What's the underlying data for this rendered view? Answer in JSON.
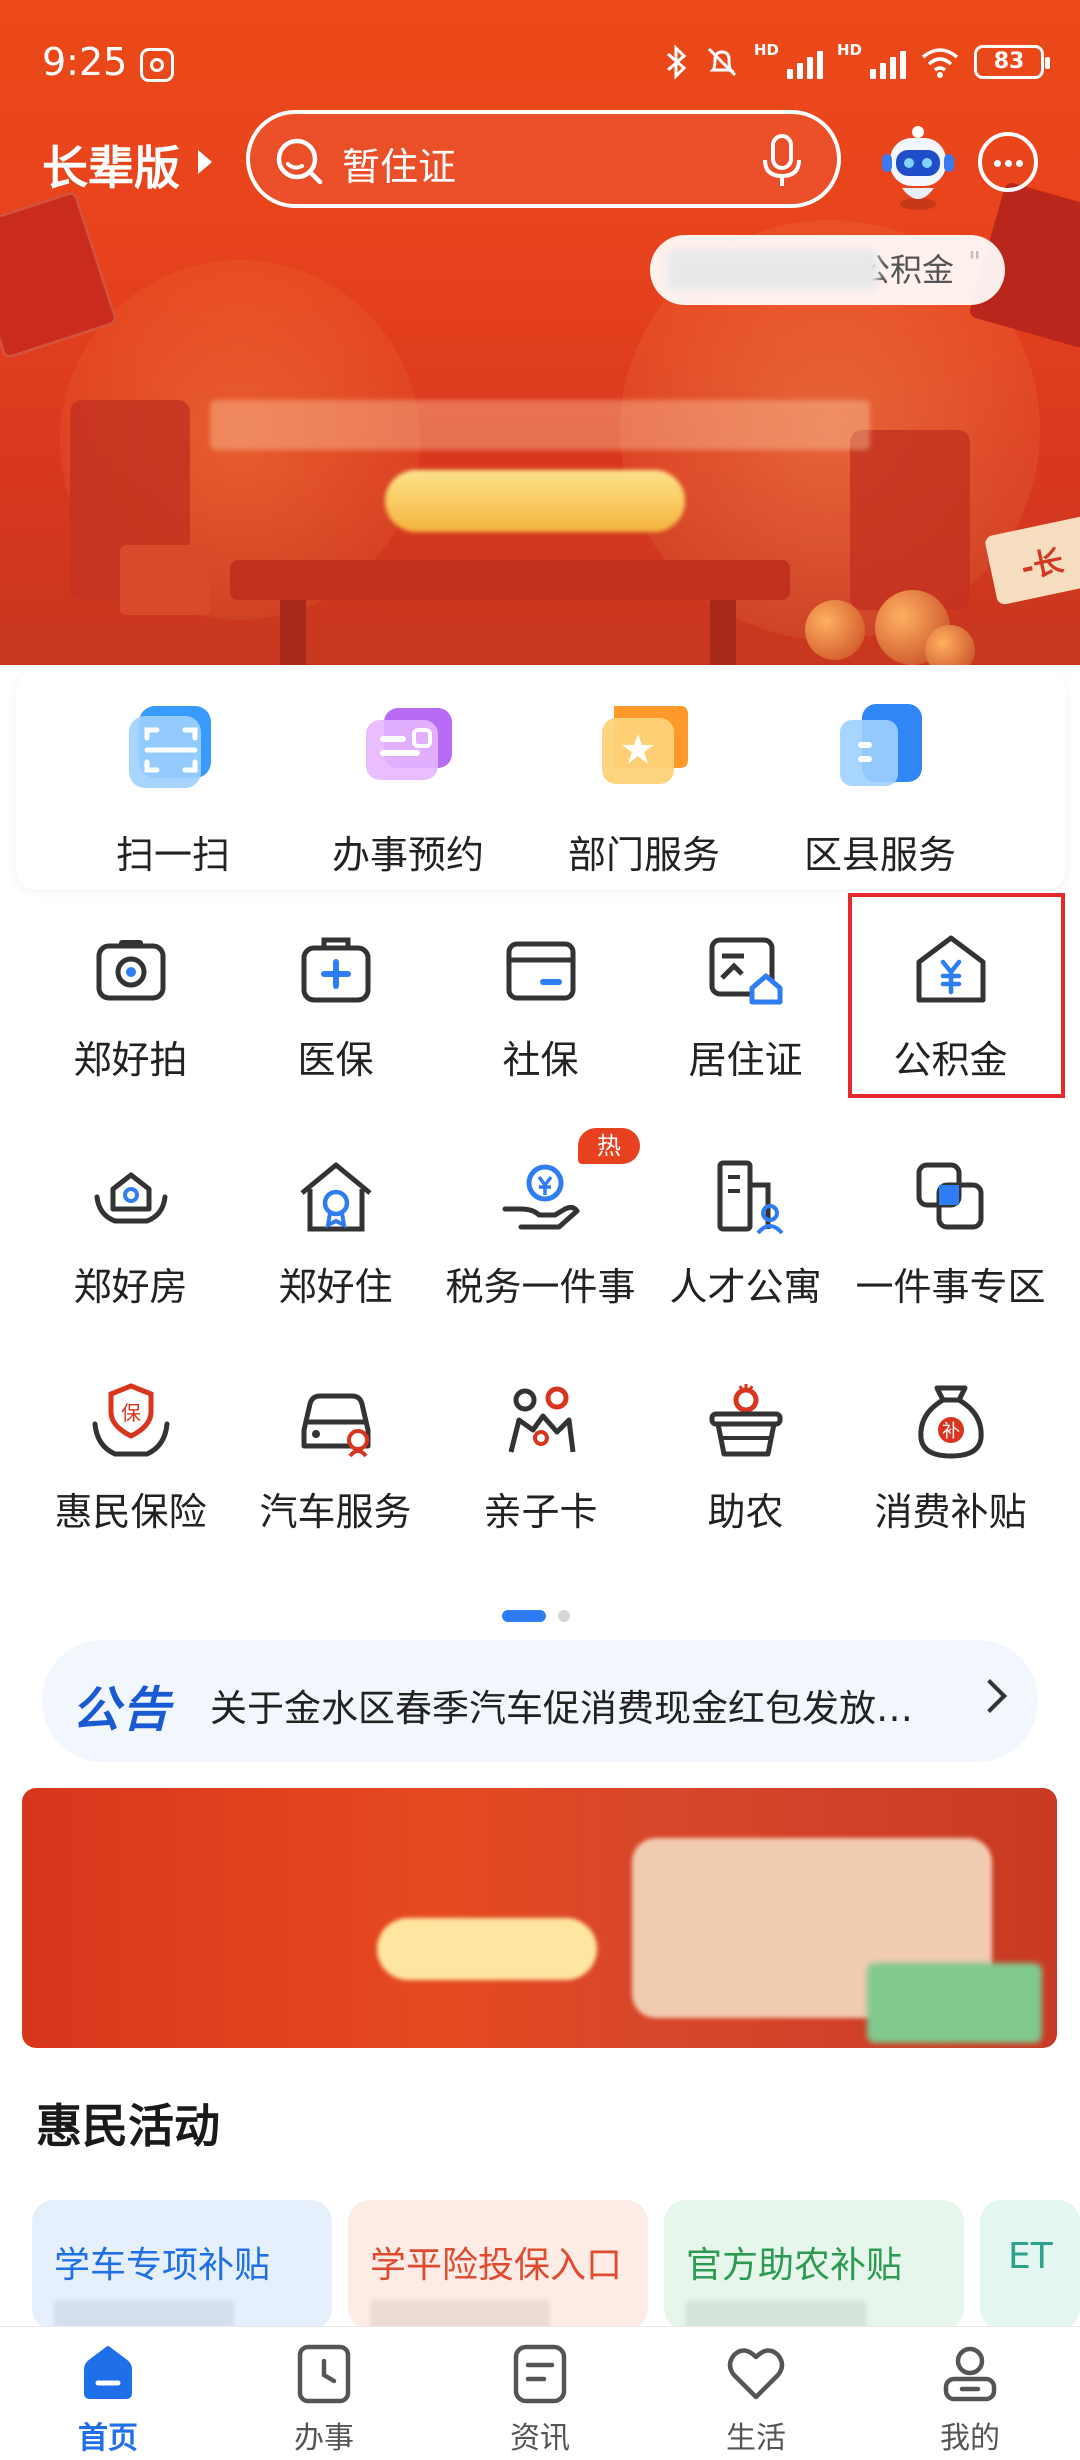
{
  "status_bar": {
    "time": "9:25",
    "battery": "83",
    "hd1": "HD",
    "hd2": "HD"
  },
  "header": {
    "elder_mode": "长辈版",
    "search_text": "暂住证",
    "popup_hint": "公积金"
  },
  "quick_row": [
    {
      "label": "扫一扫",
      "icon": "scan-icon"
    },
    {
      "label": "办事预约",
      "icon": "appointment-icon"
    },
    {
      "label": "部门服务",
      "icon": "department-icon"
    },
    {
      "label": "区县服务",
      "icon": "district-icon"
    }
  ],
  "services": [
    {
      "label": "郑好拍",
      "icon": "camera-icon"
    },
    {
      "label": "医保",
      "icon": "medical-kit-icon"
    },
    {
      "label": "社保",
      "icon": "card-icon"
    },
    {
      "label": "居住证",
      "icon": "residence-permit-icon"
    },
    {
      "label": "公积金",
      "icon": "housing-fund-icon"
    },
    {
      "label": "郑好房",
      "icon": "house-hands-icon"
    },
    {
      "label": "郑好住",
      "icon": "home-badge-icon"
    },
    {
      "label": "税务一件事",
      "icon": "tax-icon",
      "badge": "热"
    },
    {
      "label": "人才公寓",
      "icon": "apartment-icon"
    },
    {
      "label": "一件事专区",
      "icon": "stack-icon"
    },
    {
      "label": "惠民保险",
      "icon": "insurance-icon"
    },
    {
      "label": "汽车服务",
      "icon": "car-icon"
    },
    {
      "label": "亲子卡",
      "icon": "family-icon"
    },
    {
      "label": "助农",
      "icon": "farm-basket-icon"
    },
    {
      "label": "消费补贴",
      "icon": "money-bag-icon"
    }
  ],
  "notice": {
    "tag": "公告",
    "text": "关于金水区春季汽车促消费现金红包发放…"
  },
  "section_title": "惠民活动",
  "activities": [
    {
      "title": "学车专项补贴",
      "color": "#1f6fe8",
      "bg": "#e6f0fd"
    },
    {
      "title": "学平险投保入口",
      "color": "#e04a2e",
      "bg": "#fdece6"
    },
    {
      "title": "官方助农补贴",
      "color": "#2c9a52",
      "bg": "#e6f6ea"
    },
    {
      "title": "ET",
      "color": "#2fa08a",
      "bg": "#e3f6f1"
    }
  ],
  "tabs": [
    {
      "label": "首页",
      "active": true
    },
    {
      "label": "办事"
    },
    {
      "label": "资讯"
    },
    {
      "label": "生活"
    },
    {
      "label": "我的"
    }
  ],
  "colors": {
    "brand_blue": "#1f6fe8",
    "hero_red": "#e8431d",
    "highlight_red": "#e42a2a"
  }
}
